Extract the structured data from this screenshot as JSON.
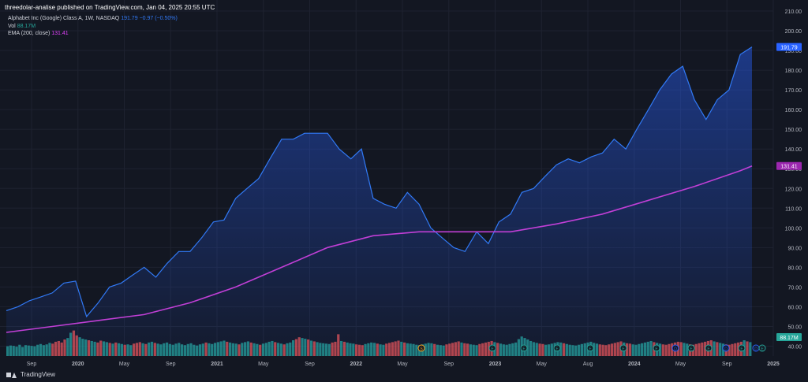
{
  "publisher": "threedolar-analise published on TradingView.com, Jan 04, 2025 20:55 UTC",
  "legend": {
    "symbol": "Alphabet Inc (Google) Class A, 1W, NASDAQ",
    "price": "191.79",
    "change": "−0.97 (−0.50%)",
    "vol_label": "Vol",
    "vol_value": "88.17M",
    "ema_label": "EMA (200, close)",
    "ema_value": "131.41"
  },
  "footer": {
    "brand": "TradingView"
  },
  "colors": {
    "price": "#3179f5",
    "ema": "#c13fd6",
    "vol_up": "#26a69a",
    "vol_down": "#ef5350",
    "background": "#131722"
  },
  "chart_data": {
    "type": "line",
    "x_labels": [
      "Sep",
      "2020",
      "May",
      "Sep",
      "2021",
      "May",
      "Sep",
      "2022",
      "May",
      "Sep",
      "2023",
      "May",
      "Aug",
      "2024",
      "May",
      "Sep",
      "2025"
    ],
    "y_ticks": [
      40,
      50,
      60,
      70,
      80,
      90,
      100,
      110,
      120,
      130,
      140,
      150,
      160,
      170,
      180,
      190,
      200,
      210
    ],
    "ylim": [
      35,
      210
    ],
    "last_price_label": "191.79",
    "last_ema_label": "131.41",
    "last_volume_label": "88.17M",
    "price": {
      "name": "Alphabet Inc (Google) Class A",
      "x": [
        "2019-08",
        "2019-09",
        "2019-10",
        "2019-11",
        "2019-12",
        "2020-01",
        "2020-02",
        "2020-03",
        "2020-04",
        "2020-05",
        "2020-06",
        "2020-07",
        "2020-08",
        "2020-09",
        "2020-10",
        "2020-11",
        "2020-12",
        "2021-01",
        "2021-02",
        "2021-03",
        "2021-04",
        "2021-05",
        "2021-06",
        "2021-07",
        "2021-08",
        "2021-09",
        "2021-10",
        "2021-11",
        "2021-12",
        "2022-01",
        "2022-02",
        "2022-03",
        "2022-04",
        "2022-05",
        "2022-06",
        "2022-07",
        "2022-08",
        "2022-09",
        "2022-10",
        "2022-11",
        "2022-12",
        "2023-01",
        "2023-02",
        "2023-03",
        "2023-04",
        "2023-05",
        "2023-06",
        "2023-07",
        "2023-08",
        "2023-09",
        "2023-10",
        "2023-11",
        "2023-12",
        "2024-01",
        "2024-02",
        "2024-03",
        "2024-04",
        "2024-05",
        "2024-06",
        "2024-07",
        "2024-08",
        "2024-09",
        "2024-10",
        "2024-11",
        "2024-12",
        "2025-01"
      ],
      "y": [
        58,
        60,
        63,
        65,
        67,
        72,
        73,
        55,
        62,
        70,
        72,
        76,
        80,
        75,
        82,
        88,
        88,
        95,
        103,
        104,
        115,
        120,
        125,
        135,
        145,
        145,
        148,
        148,
        148,
        140,
        135,
        140,
        115,
        112,
        110,
        118,
        112,
        100,
        95,
        90,
        88,
        98,
        92,
        103,
        107,
        118,
        120,
        126,
        132,
        135,
        133,
        136,
        138,
        145,
        140,
        150,
        160,
        170,
        178,
        182,
        165,
        155,
        165,
        170,
        188,
        191.79
      ]
    },
    "ema": {
      "name": "EMA (200, close)",
      "x": [
        "2019-08",
        "2019-12",
        "2020-04",
        "2020-08",
        "2020-12",
        "2021-04",
        "2021-08",
        "2021-12",
        "2022-04",
        "2022-08",
        "2022-12",
        "2023-04",
        "2023-08",
        "2023-12",
        "2024-04",
        "2024-08",
        "2024-12",
        "2025-01"
      ],
      "y": [
        47,
        50,
        53,
        56,
        62,
        70,
        80,
        90,
        96,
        98,
        98,
        98,
        102,
        107,
        114,
        121,
        129,
        131.41
      ]
    },
    "volume": {
      "name": "Vol",
      "scale_max": 210,
      "values": [
        26,
        28,
        27,
        25,
        30,
        24,
        29,
        28,
        27,
        26,
        30,
        32,
        29,
        31,
        35,
        33,
        38,
        40,
        36,
        44,
        48,
        62,
        68,
        55,
        50,
        46,
        44,
        42,
        40,
        38,
        36,
        41,
        39,
        37,
        35,
        33,
        36,
        34,
        32,
        30,
        31,
        29,
        33,
        35,
        37,
        34,
        32,
        36,
        38,
        35,
        33,
        31,
        34,
        36,
        32,
        30,
        33,
        35,
        31,
        29,
        32,
        34,
        30,
        28,
        31,
        33,
        36,
        34,
        32,
        35,
        37,
        39,
        41,
        38,
        36,
        34,
        33,
        31,
        35,
        37,
        39,
        36,
        34,
        32,
        30,
        33,
        35,
        38,
        40,
        37,
        35,
        33,
        31,
        34,
        36,
        42,
        45,
        50,
        48,
        46,
        44,
        41,
        39,
        37,
        35,
        34,
        33,
        32,
        36,
        38,
        58,
        40,
        38,
        36,
        34,
        33,
        31,
        30,
        29,
        32,
        34,
        36,
        35,
        33,
        31,
        30,
        33,
        35,
        37,
        39,
        41,
        38,
        36,
        34,
        33,
        32,
        30,
        29,
        31,
        33,
        35,
        34,
        32,
        30,
        29,
        28,
        31,
        33,
        35,
        37,
        39,
        36,
        34,
        33,
        31,
        30,
        29,
        32,
        34,
        36,
        38,
        40,
        37,
        35,
        33,
        31,
        30,
        32,
        34,
        36,
        45,
        52,
        48,
        44,
        40,
        37,
        35,
        33,
        32,
        30,
        31,
        33,
        35,
        37,
        36,
        34,
        32,
        30,
        29,
        28,
        30,
        32,
        34,
        36,
        38,
        35,
        33,
        31,
        30,
        29,
        31,
        33,
        35,
        37,
        39,
        36,
        34,
        33,
        31,
        30,
        32,
        34,
        36,
        38,
        40,
        37,
        35,
        33,
        31,
        30,
        32,
        34,
        36,
        38,
        37,
        35,
        33,
        31,
        30,
        32,
        34,
        36,
        38,
        40,
        42,
        39,
        37,
        35,
        33,
        31,
        30,
        32,
        34,
        36,
        38,
        42,
        39,
        37
      ]
    },
    "events": [
      "S",
      "E",
      "E",
      "E",
      "E",
      "E",
      "E",
      "D",
      "E",
      "E",
      "D",
      "E",
      "D",
      "E"
    ],
    "title": "",
    "xlabel": "",
    "ylabel": ""
  }
}
